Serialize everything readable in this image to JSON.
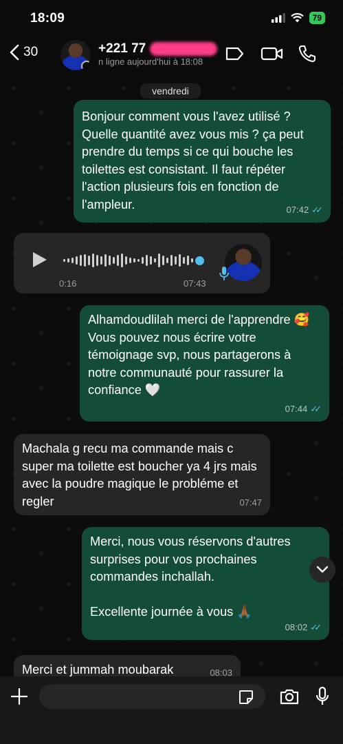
{
  "status": {
    "time": "18:09",
    "battery": "79"
  },
  "header": {
    "back_count": "30",
    "contact_name": "+221 77",
    "last_seen": "n ligne aujourd'hui à 18:08"
  },
  "chat": {
    "date": "vendredi",
    "messages": [
      {
        "text": "Bonjour comment vous l'avez utilisé ? Quelle quantité avez vous mis ? ça peut prendre du temps si ce qui bouche les toilettes est consistant. Il faut répéter l'action plusieurs fois en fonction de l'ampleur.",
        "time": "07:42"
      },
      {
        "text": "Alhamdoudlilah merci de l'apprendre 🥰\nVous pouvez nous écrire votre témoignage svp, nous partagerons à notre communauté pour rassurer la confiance 🤍",
        "time": "07:44"
      },
      {
        "text": "Machala g recu ma commande mais c super ma toilette est boucher ya 4 jrs mais avec la poudre magique le probléme et regler",
        "time": "07:47"
      },
      {
        "text": "Merci, nous vous réservons d'autres surprises pour vos prochaines commandes inchallah.\n\nExcellente journée à vous 🙏🏾",
        "time": "08:02"
      },
      {
        "text": "Merci et jummah moubarak",
        "time": "08:03"
      }
    ],
    "voice": {
      "duration": "0:16",
      "time": "07:43"
    }
  },
  "input": {
    "placeholder": ""
  },
  "colors": {
    "outgoing": "#144d37",
    "incoming": "#262626",
    "tick": "#53bdeb"
  }
}
